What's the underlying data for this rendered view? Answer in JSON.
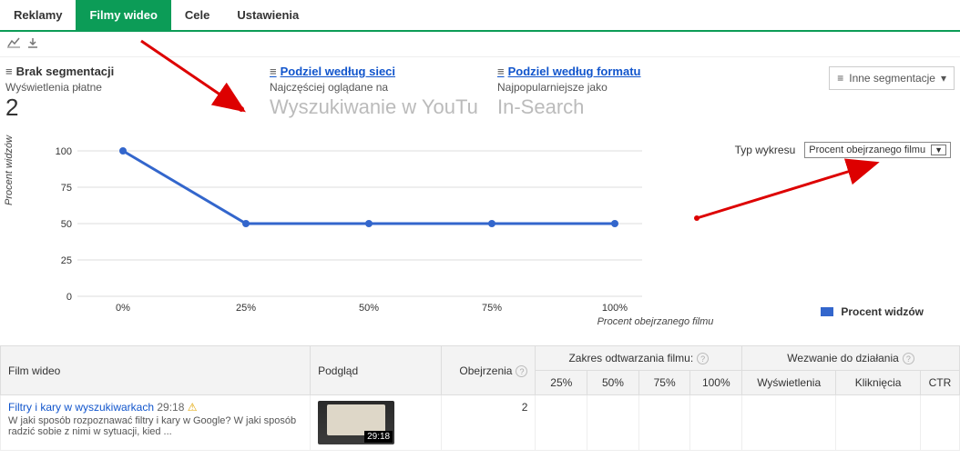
{
  "tabs": {
    "reklamy": "Reklamy",
    "filmy": "Filmy wideo",
    "cele": "Cele",
    "ustawienia": "Ustawienia"
  },
  "seg": {
    "none_label": "Brak segmentacji",
    "paid_label": "Wyświetlenia płatne",
    "paid_value": "2",
    "network_link": "Podziel według sieci",
    "network_sub": "Najczęściej oglądane na",
    "network_value": "Wyszukiwanie w YouTube",
    "format_link": "Podziel według formatu",
    "format_sub": "Najpopularniejsze jako",
    "format_value": "In-Search",
    "more": "Inne segmentacje"
  },
  "chart_controls": {
    "type_label": "Typ wykresu",
    "type_value": "Procent obejrzanego filmu"
  },
  "chart_data": {
    "type": "line",
    "title": "",
    "xlabel": "Procent obejrzanego filmu",
    "ylabel": "Procent widzów",
    "ylim": [
      0,
      100
    ],
    "categories": [
      "0%",
      "25%",
      "50%",
      "75%",
      "100%"
    ],
    "series": [
      {
        "name": "Procent widzów",
        "values": [
          100,
          50,
          50,
          50,
          50
        ]
      }
    ]
  },
  "table": {
    "headers": {
      "film": "Film wideo",
      "podglad": "Podgląd",
      "obejrzenia": "Obejrzenia",
      "zakres": "Zakres odtwarzania filmu:",
      "z25": "25%",
      "z50": "50%",
      "z75": "75%",
      "z100": "100%",
      "cta": "Wezwanie do działania",
      "wys": "Wyświetlenia",
      "klik": "Kliknięcia",
      "ctr": "CTR"
    },
    "rows": [
      {
        "title": "Filtry i kary w wyszukiwarkach",
        "duration_text": "29:18",
        "desc": "W jaki sposób rozpoznawać filtry i kary w Google? W jaki sposób radzić sobie z nimi w sytuacji, kied ...",
        "views": "2",
        "thumb_badge": "29:18"
      }
    ]
  }
}
